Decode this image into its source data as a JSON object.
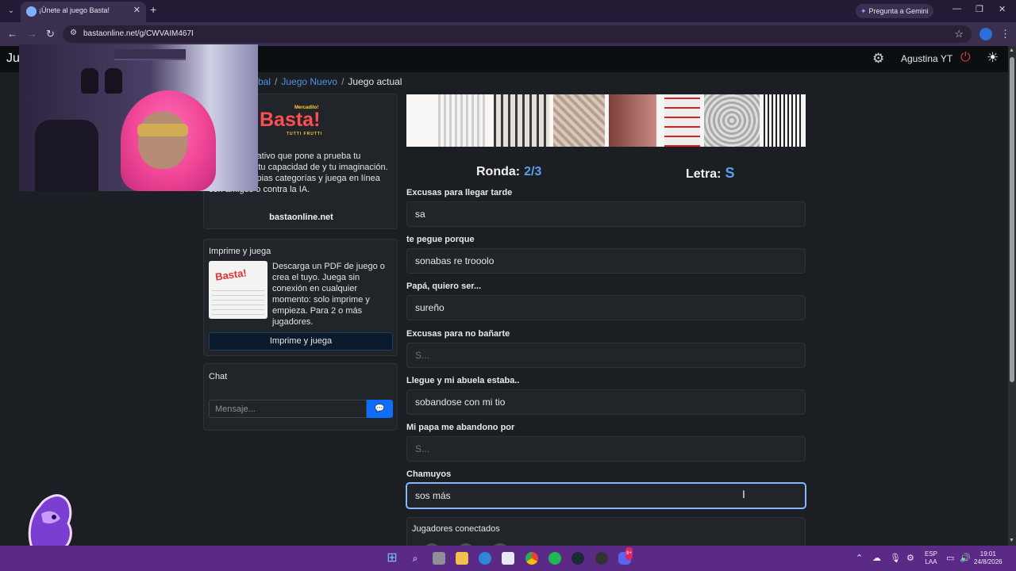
{
  "browser": {
    "tab_title": "¡Únete al juego Basta!",
    "gemini_label": "Pregunta a Gemini",
    "url": "bastaonline.net/g/CWVAIM467I"
  },
  "navbar": {
    "brand": "Ju",
    "user_name": "Agustina YT"
  },
  "breadcrumb": {
    "home": "bal",
    "new_game": "Juego Nuevo",
    "current": "Juego actual"
  },
  "about": {
    "logo_top": "Mercadito!",
    "logo": "Basta!",
    "logo_sub": "TUTTI FRUTTI",
    "text": "palabras creativo que pone a prueba tu vocabulario, tu capacidad de y tu imaginación. Crea tus propias categorías y juega en línea con amigos o contra la IA.",
    "site": "bastaonline.net"
  },
  "print_card": {
    "title": "Imprime y juega",
    "thumb_logo": "Basta!",
    "description": "Descarga un PDF de juego o crea el tuyo. Juega sin conexión en cualquier momento: solo imprime y empieza. Para 2 o más jugadores.",
    "button": "Imprime y juega"
  },
  "chat": {
    "title": "Chat",
    "placeholder": "Mensaje...",
    "send_icon": "comment-icon"
  },
  "game": {
    "round_label": "Ronda:",
    "round_value": "2/3",
    "letter_label": "Letra:",
    "letter_value": "S",
    "fields": [
      {
        "label": "Excusas para llegar tarde",
        "value": "sa",
        "placeholder": "S..."
      },
      {
        "label": "te pegue porque",
        "value": "sonabas re trooolo",
        "placeholder": "S..."
      },
      {
        "label": "Papá, quiero ser...",
        "value": "sureño",
        "placeholder": "S..."
      },
      {
        "label": "Excusas para no bañarte",
        "value": "",
        "placeholder": "S..."
      },
      {
        "label": "Llegue y mi abuela estaba..",
        "value": "sobandose con mi tio",
        "placeholder": "S..."
      },
      {
        "label": "Mi papa me abandono por",
        "value": "",
        "placeholder": "S..."
      },
      {
        "label": "Chamuyos",
        "value": "sos más",
        "placeholder": "S..."
      }
    ],
    "players_title": "Jugadores conectados"
  },
  "taskbar": {
    "lang_top": "ESP",
    "lang_bottom": "LAA",
    "time": "19:01",
    "date": "24/8/2026",
    "badge": "9+"
  },
  "colors": {
    "accent": "#0d6efd",
    "highlight": "#5aa0f0",
    "danger": "#dc3545",
    "logo": "#ff4f4f"
  }
}
